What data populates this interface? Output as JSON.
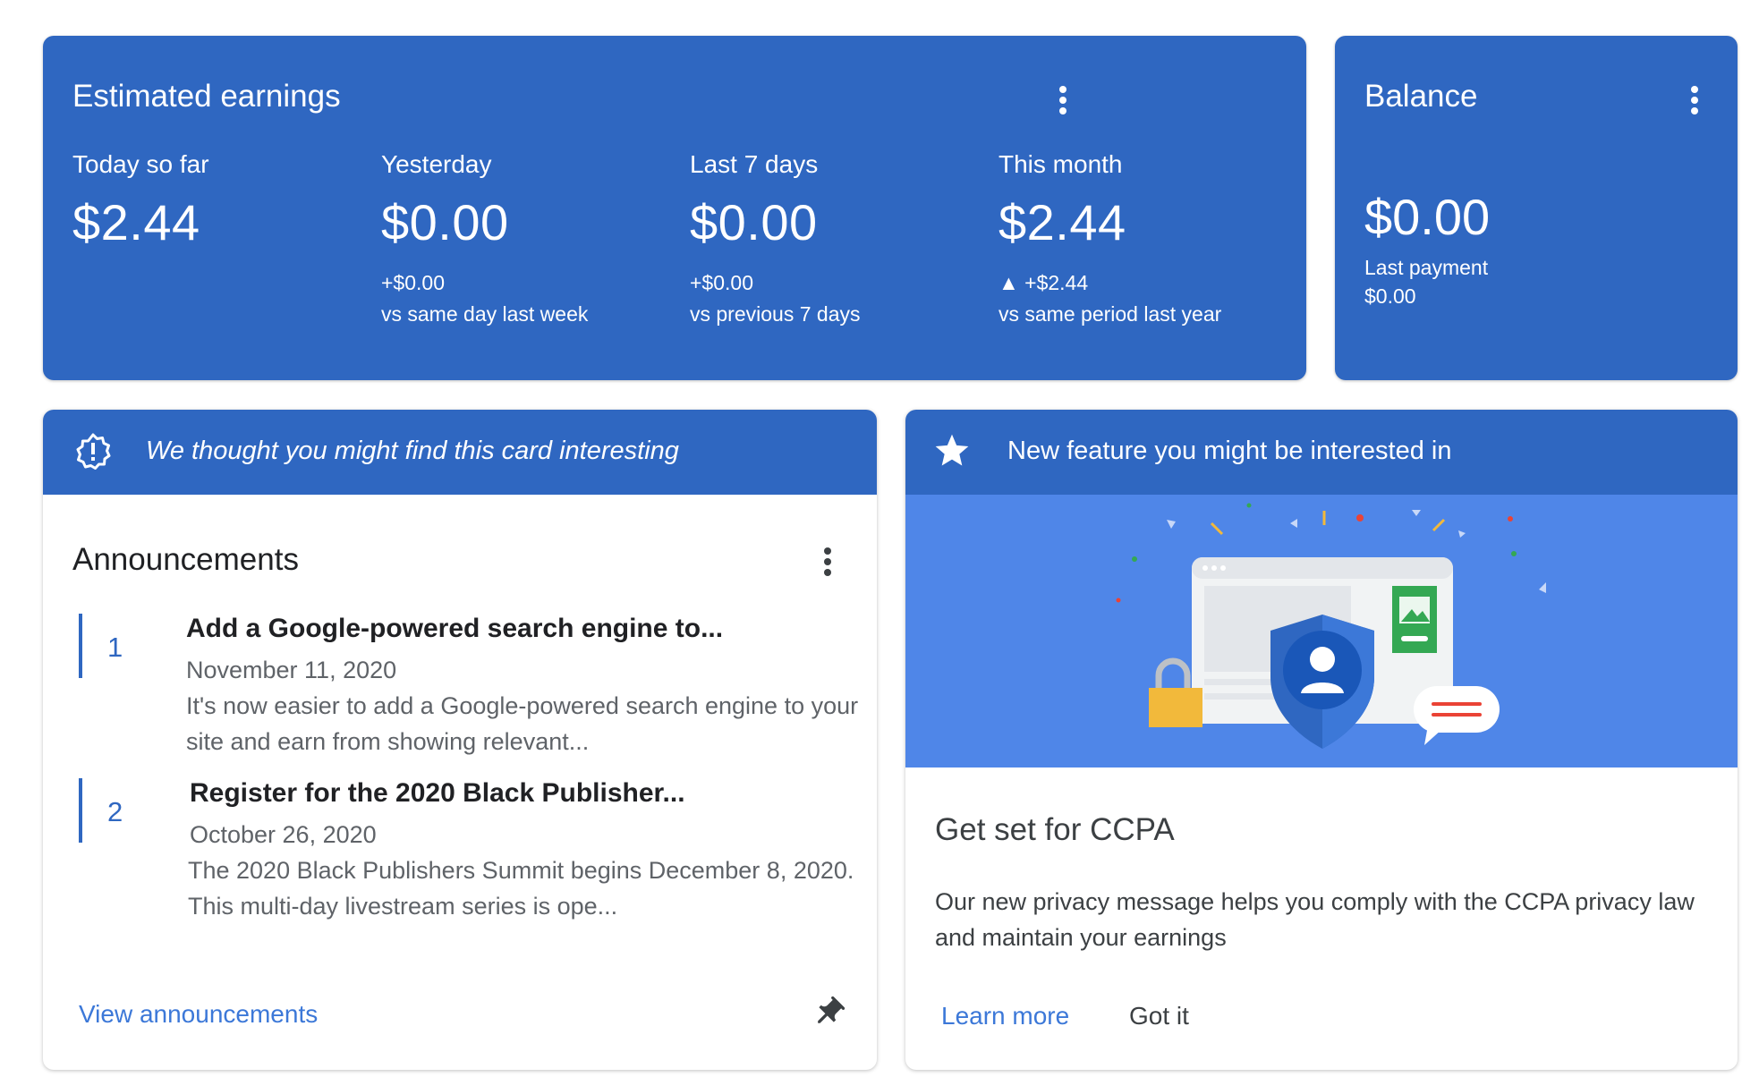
{
  "earnings": {
    "title": "Estimated earnings",
    "metrics": [
      {
        "label": "Today so far",
        "value": "$2.44",
        "delta": "",
        "comparison": ""
      },
      {
        "label": "Yesterday",
        "value": "$0.00",
        "delta": "+$0.00",
        "comparison": "vs same day last week"
      },
      {
        "label": "Last 7 days",
        "value": "$0.00",
        "delta": "+$0.00",
        "comparison": "vs previous 7 days"
      },
      {
        "label": "This month",
        "value": "$2.44",
        "delta": "▲ +$2.44",
        "comparison": "vs same period last year"
      }
    ]
  },
  "balance": {
    "title": "Balance",
    "value": "$0.00",
    "last_payment_label": "Last payment",
    "last_payment_value": "$0.00"
  },
  "announcements_card": {
    "header": "We thought you might find this card interesting",
    "title": "Announcements",
    "items": [
      {
        "number": "1",
        "title": "Add a Google-powered search engine to...",
        "date": "November 11, 2020",
        "desc": "It's now easier to add a Google-powered search engine to your site and earn from showing relevant..."
      },
      {
        "number": "2",
        "title": "Register for the 2020 Black Publisher...",
        "date": "October 26, 2020",
        "desc": "The 2020 Black Publishers Summit begins December 8, 2020. This multi-day livestream series is ope..."
      }
    ],
    "view_link": "View announcements"
  },
  "feature_card": {
    "header": "New feature you might be interested in",
    "title": "Get set for CCPA",
    "desc": "Our new privacy message helps you comply with the CCPA privacy law and maintain your earnings",
    "learn_more": "Learn more",
    "got_it": "Got it"
  },
  "colors": {
    "brand_blue": "#2f67c1",
    "illustration_blue": "#4f86e8",
    "link_blue": "#3c78d8"
  },
  "icons": [
    "more-vert-icon",
    "warning-badge-icon",
    "star-icon",
    "pin-icon",
    "privacy-shield-illustration"
  ]
}
